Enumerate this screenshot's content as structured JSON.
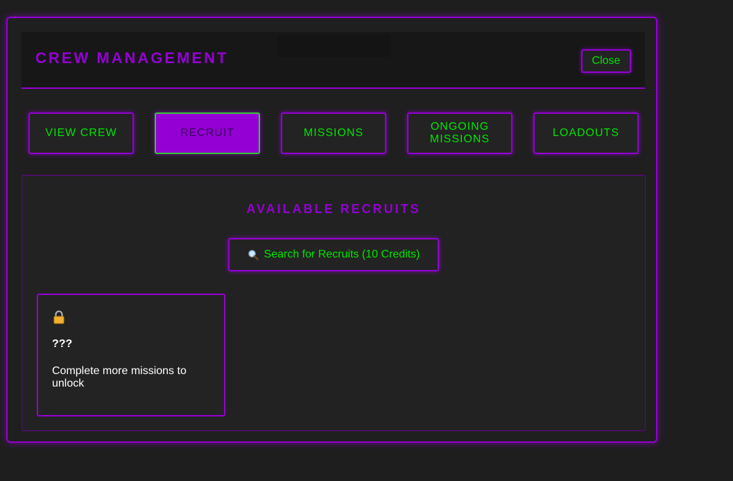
{
  "modal": {
    "title": "CREW MANAGEMENT",
    "close_label": "Close"
  },
  "tabs": [
    {
      "label": "VIEW CREW",
      "active": false
    },
    {
      "label": "RECRUIT",
      "active": true
    },
    {
      "label": "MISSIONS",
      "active": false
    },
    {
      "label": "ONGOING MISSIONS",
      "active": false
    },
    {
      "label": "LOADOUTS",
      "active": false
    }
  ],
  "recruits": {
    "title": "AVAILABLE RECRUITS",
    "search_label": "Search for Recruits (10 Credits)",
    "search_icon": "magnifier-icon",
    "cards": [
      {
        "icon": "lock-icon",
        "name": "???",
        "description": "Complete more missions to unlock"
      }
    ]
  },
  "colors": {
    "accent_purple": "#9400d3",
    "text_green": "#00e600",
    "active_border_green": "#32cd32",
    "background": "#1e1e1e"
  }
}
